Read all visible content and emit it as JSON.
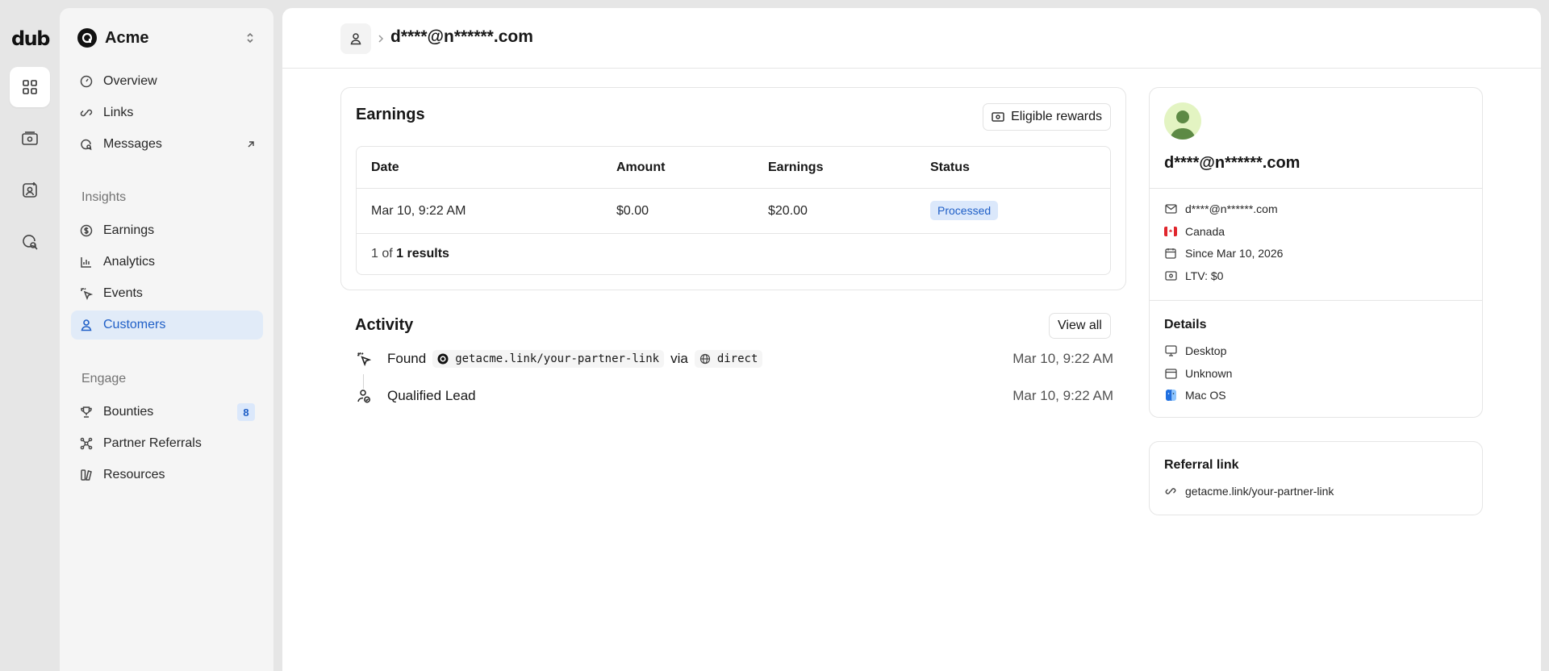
{
  "brand": {
    "logo_text": "dub"
  },
  "workspace": {
    "name": "Acme"
  },
  "nav": {
    "overview": "Overview",
    "links": "Links",
    "messages": "Messages",
    "insights_label": "Insights",
    "earnings": "Earnings",
    "analytics": "Analytics",
    "events": "Events",
    "customers": "Customers",
    "engage_label": "Engage",
    "bounties": "Bounties",
    "bounties_count": "8",
    "partner_referrals": "Partner Referrals",
    "resources": "Resources"
  },
  "header": {
    "title": "d****@n******.com"
  },
  "earnings": {
    "title": "Earnings",
    "eligible_button": "Eligible rewards",
    "columns": [
      "Date",
      "Amount",
      "Earnings",
      "Status"
    ],
    "rows": [
      {
        "date": "Mar 10, 9:22 AM",
        "amount": "$0.00",
        "earnings": "$20.00",
        "status": "Processed"
      }
    ],
    "footer_prefix": "1 of",
    "footer_count": "1 results"
  },
  "activity": {
    "title": "Activity",
    "view_all": "View all",
    "events": [
      {
        "label": "Found",
        "link": "getacme.link/your-partner-link",
        "via": "via",
        "source": "direct",
        "time": "Mar 10, 9:22 AM"
      },
      {
        "label": "Qualified Lead",
        "time": "Mar 10, 9:22 AM"
      }
    ]
  },
  "customer": {
    "name": "d****@n******.com",
    "email": "d****@n******.com",
    "country": "Canada",
    "since": "Since Mar 10, 2026",
    "ltv": "LTV: $0",
    "details_title": "Details",
    "device": "Desktop",
    "browser": "Unknown",
    "os": "Mac OS"
  },
  "referral": {
    "title": "Referral link",
    "link": "getacme.link/your-partner-link"
  },
  "colors": {
    "accent": "#1f5fc7",
    "accent_bg": "#e1ebf8"
  }
}
